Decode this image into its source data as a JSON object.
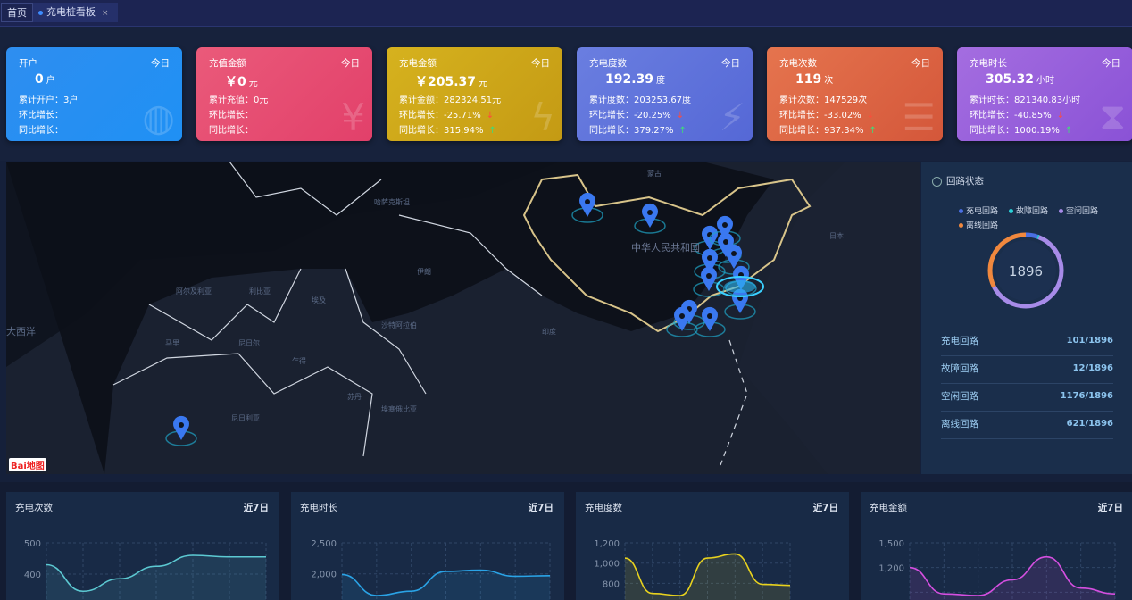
{
  "tabs": [
    {
      "label": "首页"
    },
    {
      "label": "充电桩看板",
      "close": "×"
    }
  ],
  "cards": [
    {
      "title": "开户",
      "period": "今日",
      "value": "0",
      "unit": "户",
      "total": "累计开户：3户",
      "mom": "环比增长：",
      "yoy": "同比增长：",
      "mom_dir": "",
      "yoy_dir": "",
      "color1": "#2e8ef0",
      "color2": "#1f90f4",
      "icon": "globe-user-icon"
    },
    {
      "title": "充值金额",
      "period": "今日",
      "value": "￥0",
      "unit": "元",
      "total": "累计充值：0元",
      "mom": "环比增长：",
      "yoy": "同比增长：",
      "mom_dir": "",
      "yoy_dir": "",
      "color1": "#ea5a7a",
      "color2": "#e2406a",
      "icon": "money-bag-icon"
    },
    {
      "title": "充电金额",
      "period": "今日",
      "value": "￥205.37",
      "unit": "元",
      "total": "累计金额：282324.51元",
      "mom": "环比增长：-25.71%",
      "yoy": "同比增长：315.94%",
      "mom_dir": "down",
      "yoy_dir": "up",
      "color1": "#d6b21e",
      "color2": "#c49a14",
      "icon": "charge-money-icon"
    },
    {
      "title": "充电度数",
      "period": "今日",
      "value": "192.39",
      "unit": "度",
      "total": "累计度数：203253.67度",
      "mom": "环比增长：-20.25%",
      "yoy": "同比增长：379.27%",
      "mom_dir": "down",
      "yoy_dir": "up",
      "color1": "#6a7ee0",
      "color2": "#5568d6",
      "icon": "charging-station-icon"
    },
    {
      "title": "充电次数",
      "period": "今日",
      "value": "119",
      "unit": "次",
      "total": "累计次数：147529次",
      "mom": "环比增长：-33.02%",
      "yoy": "同比增长：937.34%",
      "mom_dir": "down",
      "yoy_dir": "up",
      "color1": "#e5744e",
      "color2": "#d4573a",
      "icon": "database-check-icon"
    },
    {
      "title": "充电时长",
      "period": "今日",
      "value": "305.32",
      "unit": "小时",
      "total": "累计时长：821340.83小时",
      "mom": "环比增长：-40.85%",
      "yoy": "同比增长：1000.19%",
      "mom_dir": "down",
      "yoy_dir": "up",
      "color1": "#a46de0",
      "color2": "#8a52d6",
      "icon": "hourglass-icon"
    }
  ],
  "map": {
    "labels": [
      "大西洋",
      "阿尔及利亚",
      "利比亚",
      "埃及",
      "沙特阿拉伯",
      "伊朗",
      "印度",
      "中华人民共和国",
      "蒙古",
      "日本",
      "哈萨克斯坦",
      "尼日利亚",
      "马里",
      "尼日尔",
      "乍得",
      "苏丹",
      "埃塞俄比亚"
    ],
    "logo": "Bai地图"
  },
  "loop_status": {
    "title": "回路状态",
    "total": "1896",
    "items": [
      {
        "label": "充电回路",
        "value": 101,
        "text": "101/1896",
        "color": "#4a6fe3"
      },
      {
        "label": "故障回路",
        "value": 12,
        "text": "12/1896",
        "color": "#2ad1d8"
      },
      {
        "label": "空闲回路",
        "value": 1176,
        "text": "1176/1896",
        "color": "#a78be8"
      },
      {
        "label": "离线回路",
        "value": 621,
        "text": "621/1896",
        "color": "#f0883e"
      }
    ]
  },
  "chart_data": [
    {
      "type": "area",
      "title": "充电次数",
      "period": "近7日",
      "yticks": [
        "500",
        "400"
      ],
      "ytick_values": [
        500,
        400
      ],
      "values": [
        430,
        345,
        385,
        425,
        460,
        455,
        455
      ],
      "color": "#5cc9d2"
    },
    {
      "type": "area",
      "title": "充电时长",
      "period": "近7日",
      "yticks": [
        "2,500",
        "2,000"
      ],
      "ytick_values": [
        2500,
        2000
      ],
      "values": [
        1990,
        1650,
        1720,
        2040,
        2060,
        1960,
        1970
      ],
      "color": "#2aa3e6"
    },
    {
      "type": "area",
      "title": "充电度数",
      "period": "近7日",
      "yticks": [
        "1,200",
        "1,000",
        "800"
      ],
      "ytick_values": [
        1200,
        1000,
        800
      ],
      "values": [
        1050,
        700,
        680,
        1050,
        1090,
        790,
        780
      ],
      "color": "#e8d21e"
    },
    {
      "type": "area",
      "title": "充电金额",
      "period": "近7日",
      "yticks": [
        "1,500",
        "1,200"
      ],
      "ytick_values": [
        1500,
        1200
      ],
      "values": [
        1200,
        880,
        860,
        1050,
        1330,
        950,
        880
      ],
      "color": "#d54fe0"
    }
  ]
}
